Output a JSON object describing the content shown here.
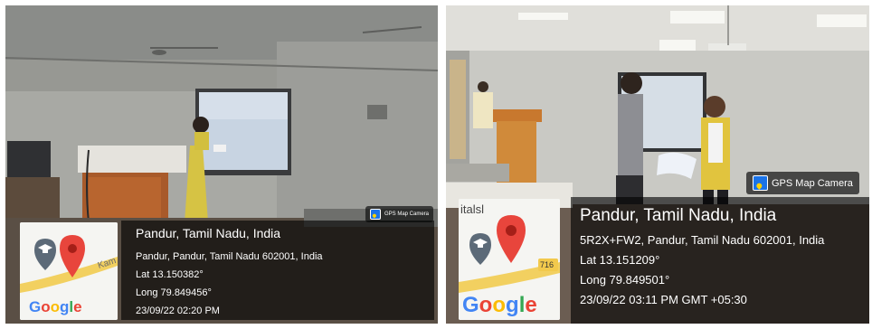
{
  "photos": [
    {
      "badge": {
        "brand": "GPS Map Camera",
        "icon": "gps-map-camera-icon"
      },
      "map": {
        "logo": "Google",
        "road_label": "Kam",
        "road_number": ""
      },
      "location": {
        "title": "Pandur, Tamil Nadu, India",
        "address": "Pandur, Pandur, Tamil Nadu 602001, India",
        "lat": "Lat 13.150382°",
        "long": "Long 79.849456°",
        "datetime": "23/09/22 02:20 PM"
      }
    },
    {
      "badge": {
        "brand": "GPS Map Camera",
        "icon": "gps-map-camera-icon"
      },
      "map": {
        "logo": "Google",
        "road_label": "",
        "road_number": "716",
        "place_text": "italsl"
      },
      "location": {
        "title": "Pandur, Tamil Nadu, India",
        "address": "5R2X+FW2, Pandur, Tamil Nadu 602001, India",
        "lat": "Lat 13.151209°",
        "long": "Long 79.849501°",
        "datetime": "23/09/22 03:11 PM GMT +05:30"
      }
    }
  ],
  "colors": {
    "pin_red": "#e8453c",
    "road_yellow": "#f2d060",
    "google_blue": "#4285f4",
    "badge_blue": "#1a73e8"
  }
}
